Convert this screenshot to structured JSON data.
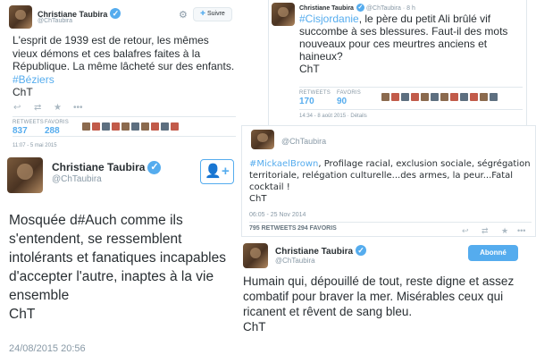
{
  "tweet1": {
    "name": "Christiane Taubira",
    "handle": "@ChTaubira",
    "follow_label": "Suivre",
    "text_parts": [
      "L'esprit de 1939 est de retour, les mêmes vieux démons et ces balafres faites à la République. La même lâcheté sur des enfants. ",
      "#Béziers"
    ],
    "signature": "ChT",
    "retweets_label": "RETWEETS",
    "retweets": "837",
    "favorites_label": "FAVORIS",
    "favorites": "288",
    "timestamp": "11:07 - 5 mai 2015"
  },
  "tweet2": {
    "name": "Christiane Taubira",
    "handle": "@ChTaubira",
    "time_ago": "8 h",
    "text_parts": [
      "#Cisjordanie",
      ", le père du petit Ali brûlé vif succombe à ses blessures. Faut-il des mots nouveaux pour ces meurtres anciens et haineux?"
    ],
    "signature": "ChT",
    "retweets_label": "RETWEETS",
    "retweets": "170",
    "favorites_label": "FAVORIS",
    "favorites": "90",
    "timestamp": "14:34 - 8 août 2015 · Détails"
  },
  "tweet3": {
    "handle": "@ChTaubira",
    "text_parts": [
      "#MickaelBrown",
      ", Profilage racial, exclusion sociale, ségrégation territoriale, relégation culturelle...des armes, la peur...Fatal cocktail !"
    ],
    "signature": "ChT",
    "timestamp": "06:05 - 25 Nov 2014",
    "retweets": "795 RETWEETS",
    "favorites": "294 FAVORIS"
  },
  "tweet4": {
    "name": "Christiane Taubira",
    "handle": "@ChTaubira",
    "text": "Mosquée d#Auch comme ils s'entendent, se ressemblent intolérants et fanatiques incapables d'accepter l'autre, inaptes à la vie ensemble",
    "signature": "ChT",
    "timestamp": "24/08/2015 20:56"
  },
  "tweet5": {
    "name": "Christiane Taubira",
    "handle": "@ChTaubira",
    "subscribed_label": "Abonné",
    "text": "Humain qui, dépouillé de tout, reste digne et assez combatif pour braver la mer. Misérables ceux qui ricanent et rêvent de sang bleu.",
    "signature": "ChT"
  },
  "colors": {
    "accent": "#55acee",
    "text": "#292f33",
    "muted": "#8899a6"
  },
  "icons": [
    "verified-icon",
    "reply-icon",
    "retweet-icon",
    "favorite-icon",
    "more-icon",
    "gear-icon",
    "follow-icon"
  ]
}
